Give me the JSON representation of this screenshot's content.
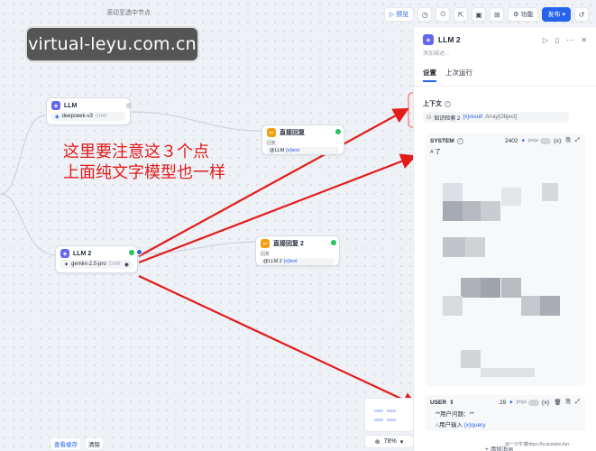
{
  "canvas": {
    "scroll_hint": "滚动至选中节点"
  },
  "toolbar": {
    "preview_label": "预览",
    "features_label": "功能",
    "publish_label": "发布",
    "icons": [
      "history-check-icon",
      "clock-icon",
      "export-icon",
      "split-icon",
      "grid-icon",
      "history-icon"
    ]
  },
  "watermark": {
    "text": "virtual-leyu.com.cn"
  },
  "nodes": {
    "llm1": {
      "title": "LLM",
      "model": "deepseek-v3",
      "tag": "CHAT"
    },
    "answer1": {
      "title": "直接回复",
      "sub_label": "回复",
      "var_prefix": "@LLM",
      "var_name": "{x}text"
    },
    "llm2": {
      "title": "LLM 2",
      "model": "gemini-2.5-pro",
      "tag": "CHAT"
    },
    "answer2": {
      "title": "直接回复 2",
      "sub_label": "回复",
      "var_prefix": "@LLM 2",
      "var_name": "{x}text"
    }
  },
  "annotation": {
    "line1": "这里要注意这３个点",
    "line2": "上面纯文字模型也一样"
  },
  "panel": {
    "title": "LLM 2",
    "description": "添加描述...",
    "tabs": [
      {
        "label": "设置"
      },
      {
        "label": "上次运行"
      }
    ],
    "context": {
      "label": "上下文",
      "source": "知识检索 2",
      "var": "{x}result",
      "type": "Array[Object]"
    },
    "system": {
      "label": "SYSTEM",
      "count": "2402",
      "jinja": "jinja",
      "first_line": "# 了"
    },
    "user": {
      "label": "USER",
      "count": "29",
      "jinja": "jinja",
      "line1": "**用户问题：**",
      "input_prefix": "用户输入",
      "input_var": "{x}query"
    },
    "add_message": "+ 添加消息"
  },
  "bottom": {
    "view_cache": "查看缓存",
    "clear": "清除",
    "zoom": "78%"
  },
  "footnote": "@一只牛博https://hi.acowbo.fun",
  "colors": {
    "accent": "#2563eb",
    "annotation": "#e31b1b",
    "ok": "#22c55e"
  }
}
